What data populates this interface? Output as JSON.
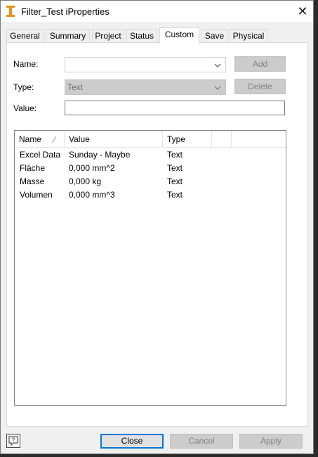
{
  "window": {
    "title": "Filter_Test iProperties",
    "close_glyph": "✕"
  },
  "tabs": [
    {
      "label": "General",
      "active": false
    },
    {
      "label": "Summary",
      "active": false
    },
    {
      "label": "Project",
      "active": false
    },
    {
      "label": "Status",
      "active": false
    },
    {
      "label": "Custom",
      "active": true
    },
    {
      "label": "Save",
      "active": false
    },
    {
      "label": "Physical",
      "active": false
    }
  ],
  "form": {
    "name_label": "Name:",
    "name_value": "",
    "type_label": "Type:",
    "type_value": "Text",
    "value_label": "Value:",
    "value_value": "",
    "add_label": "Add",
    "delete_label": "Delete"
  },
  "table": {
    "columns": [
      "Name",
      "Value",
      "Type",
      ""
    ],
    "rows": [
      {
        "name": "Excel Data",
        "value": "Sunday - Maybe",
        "type": "Text"
      },
      {
        "name": "Fläche",
        "value": "0,000 mm^2",
        "type": "Text"
      },
      {
        "name": "Masse",
        "value": "0,000 kg",
        "type": "Text"
      },
      {
        "name": "Volumen",
        "value": "0,000 mm^3",
        "type": "Text"
      }
    ]
  },
  "footer": {
    "close_label": "Close",
    "cancel_label": "Cancel",
    "apply_label": "Apply"
  },
  "colors": {
    "accent": "#0078d7",
    "app_icon": "#e8911b"
  }
}
